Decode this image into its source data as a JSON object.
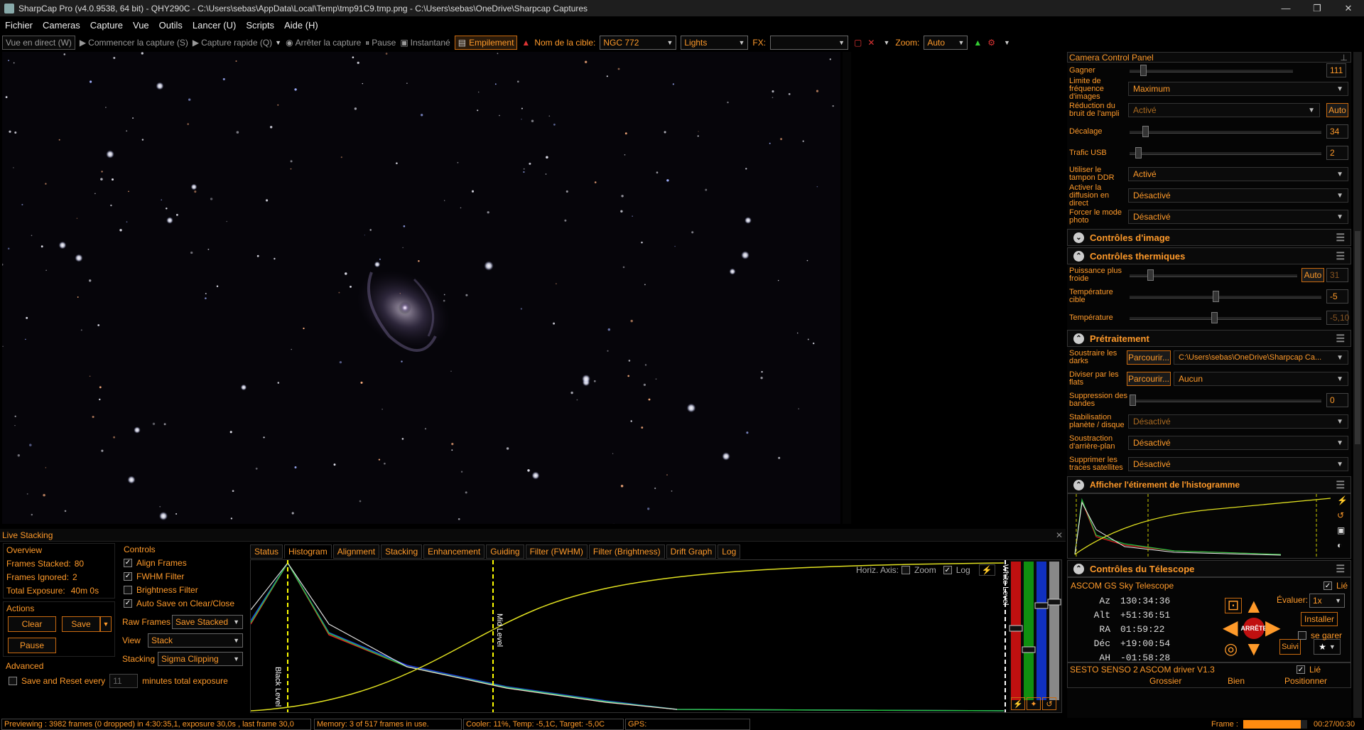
{
  "window": {
    "title": "SharpCap Pro (v4.0.9538, 64 bit) - QHY290C - C:\\Users\\sebas\\AppData\\Local\\Temp\\tmp91C9.tmp.png - C:\\Users\\sebas\\OneDrive\\Sharpcap Captures",
    "minimize": "—",
    "maximize": "❐",
    "close": "✕"
  },
  "menu": [
    "Fichier",
    "Cameras",
    "Capture",
    "Vue",
    "Outils",
    "Lancer (U)",
    "Scripts",
    "Aide (H)"
  ],
  "toolbar": {
    "live_view": "Vue en direct (W)",
    "start_capture": "Commencer la capture (S)",
    "quick_capture": "Capture rapide (Q)",
    "stop_capture": "Arrêter la capture",
    "pause": "Pause",
    "snapshot": "Instantané",
    "stacking": "Empilement",
    "target_label": "Nom de la cible:",
    "target_value": "NGC 772",
    "frame_type": "Lights",
    "fx_label": "FX:",
    "fx_value": "",
    "zoom_label": "Zoom:",
    "zoom_value": "Auto"
  },
  "camera_panel": {
    "title": "Camera Control Panel",
    "controls": [
      {
        "label": "Gagner",
        "type": "slider",
        "value": "111",
        "level": 0.07
      },
      {
        "label": "Limite de fréquence d'images",
        "type": "select",
        "value": "Maximum"
      },
      {
        "label": "Réduction du bruit de l'ampli",
        "type": "select",
        "value": "Activé",
        "auto": "Auto"
      },
      {
        "label": "Décalage",
        "type": "slider",
        "value": "34",
        "level": 0.07
      },
      {
        "label": "Trafic USB",
        "type": "slider",
        "value": "2",
        "level": 0.03
      },
      {
        "label": "Utiliser le tampon DDR",
        "type": "select",
        "value": "Activé"
      },
      {
        "label": "Activer la diffusion en direct",
        "type": "select",
        "value": "Désactivé"
      },
      {
        "label": "Forcer le mode photo",
        "type": "select",
        "value": "Désactivé"
      }
    ]
  },
  "sections": {
    "image_controls": "Contrôles d'image",
    "thermal": "Contrôles thermiques",
    "preprocessing": "Prétraitement",
    "histogram_stretch": "Afficher l'étirement de l'histogramme",
    "telescope": "Contrôles du Télescope"
  },
  "thermal": [
    {
      "label": "Puissance plus froide",
      "auto": "Auto",
      "value": "31",
      "level": 0.11
    },
    {
      "label": "Température cible",
      "value": "-5",
      "level": 0.45
    },
    {
      "label": "Température",
      "value": "-5,10",
      "level": 0.44
    }
  ],
  "preprocessing": [
    {
      "label": "Soustraire les darks",
      "button": "Parcourir...",
      "value": "C:\\Users\\sebas\\OneDrive\\Sharpcap Ca..."
    },
    {
      "label": "Diviser par les flats",
      "button": "Parcourir...",
      "value": "Aucun"
    },
    {
      "label": "Suppression des bandes",
      "value": "0",
      "level": 0.0
    },
    {
      "label": "Stabilisation planète / disque",
      "value": "Désactivé"
    },
    {
      "label": "Soustraction d'arrière-plan",
      "value": "Désactivé"
    },
    {
      "label": "Supprimer les traces satellites",
      "value": "Désactivé"
    }
  ],
  "telescope": {
    "mount": "ASCOM GS Sky Telescope",
    "linked_label": "Lié",
    "az_label": "Az",
    "az": "130:34:36",
    "alt_label": "Alt",
    "alt": "+51:36:51",
    "ra_label": "RA",
    "ra": "01:59:22",
    "dec_label": "Déc",
    "dec": "+19:00:54",
    "ha_label": "AH",
    "ha": "-01:58:28",
    "rate_label": "Évaluer:",
    "rate": "1x",
    "install": "Installer",
    "park": "se garer",
    "track": "Suivi",
    "stop": "ARRÊTE",
    "focuser": "SESTO SENSO 2 ASCOM driver V1.3",
    "focuser_linked": "Lié",
    "coarse": "Grossier",
    "fine": "Bien",
    "position": "Positionner"
  },
  "live_stacking": {
    "title": "Live Stacking",
    "overview_title": "Overview",
    "frames_stacked_label": "Frames Stacked:",
    "frames_stacked": "80",
    "frames_ignored_label": "Frames Ignored:",
    "frames_ignored": "2",
    "total_exposure_label": "Total Exposure:",
    "total_exposure": "40m 0s",
    "actions_title": "Actions",
    "clear": "Clear",
    "save": "Save",
    "pause": "Pause",
    "advanced_title": "Advanced",
    "save_reset": "Save and Reset every",
    "minutes_value": "11",
    "minutes_label": "minutes total exposure",
    "controls_title": "Controls",
    "align_frames": "Align Frames",
    "fwhm_filter": "FWHM Filter",
    "brightness_filter": "Brightness Filter",
    "auto_save": "Auto Save on Clear/Close",
    "raw_frames_label": "Raw Frames",
    "raw_frames": "Save Stacked",
    "view_label": "View",
    "view": "Stack",
    "stacking_label": "Stacking",
    "stacking": "Sigma Clipping",
    "tabs": [
      "Status",
      "Histogram",
      "Alignment",
      "Stacking",
      "Enhancement",
      "Guiding",
      "Filter (FWHM)",
      "Filter (Brightness)",
      "Drift Graph",
      "Log"
    ],
    "horiz_axis": "Horiz. Axis:",
    "zoom": "Zoom",
    "log": "Log",
    "black_level": "Black Level",
    "mid_level": "Mid Level",
    "white_level": "White Level"
  },
  "status": {
    "preview": "Previewing : 3982 frames (0 dropped) in 4:30:35,1, exposure 30,0s , last frame 30,0",
    "memory": "Memory: 3 of 517 frames in use.",
    "cooler": "Cooler: 11%, Temp: -5,1C, Target: -5,0C",
    "gps": "GPS:",
    "frame_label": "Frame :",
    "frame_time": "00:27/00:30",
    "frame_progress": 0.9
  },
  "colors": {
    "accent": "#ff9a2a",
    "background": "#000000"
  }
}
